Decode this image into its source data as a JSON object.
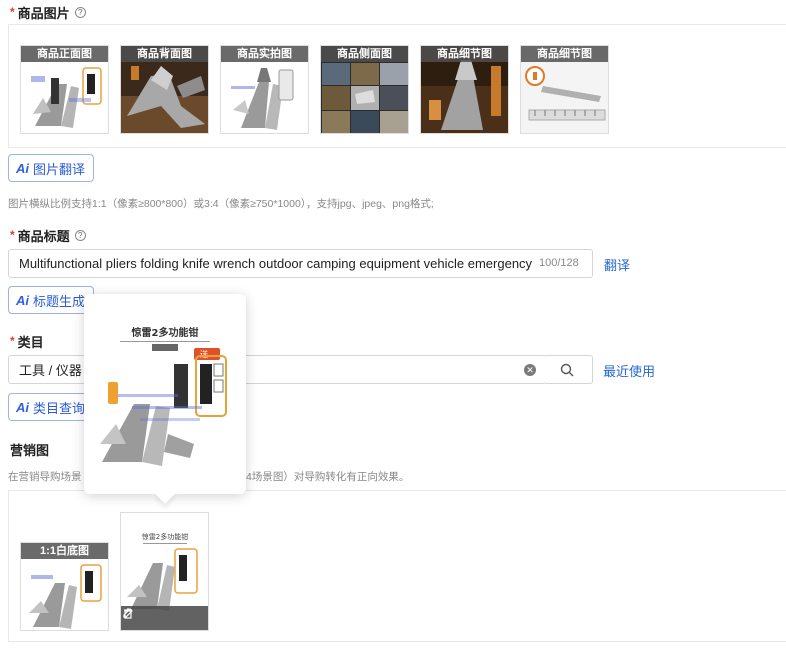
{
  "product_images": {
    "label": "商品图片",
    "required_mark": "*",
    "thumbnails": [
      {
        "caption": "商品正面图",
        "style": "white"
      },
      {
        "caption": "商品背面图",
        "style": "dark"
      },
      {
        "caption": "商品实拍图",
        "style": "white"
      },
      {
        "caption": "商品侧面图",
        "style": "collage"
      },
      {
        "caption": "商品细节图",
        "style": "dark"
      },
      {
        "caption": "商品细节图",
        "style": "ruler"
      }
    ],
    "translate_button": "图片翻译",
    "hint": "图片横纵比例支持1:1（像素≥800*800）或3:4（像素≥750*1000），支持jpg、jpeg、png格式;"
  },
  "title_field": {
    "label": "商品标题",
    "value": "Multifunctional pliers folding knife wrench outdoor camping equipment vehicle emergency",
    "count": "100/128",
    "translate_link": "翻译",
    "generate_button": "标题生成"
  },
  "category": {
    "label": "类目",
    "value": "工具 / 仪器",
    "recent_link": "最近使用",
    "query_button": "类目查询"
  },
  "marketing": {
    "label": "营销图",
    "hint_left": "在营销导购场景",
    "hint_right": "4场景图）对导购转化有正向效果。",
    "thumb_caption": "1:1白底图"
  },
  "popover": {
    "product_title": "惊雷2多功能钳",
    "badge": "送"
  },
  "ai_mark": "Ai",
  "colors": {
    "link": "#2468d2",
    "ai_accent": "#2f5fe0",
    "required": "#e4393c"
  }
}
